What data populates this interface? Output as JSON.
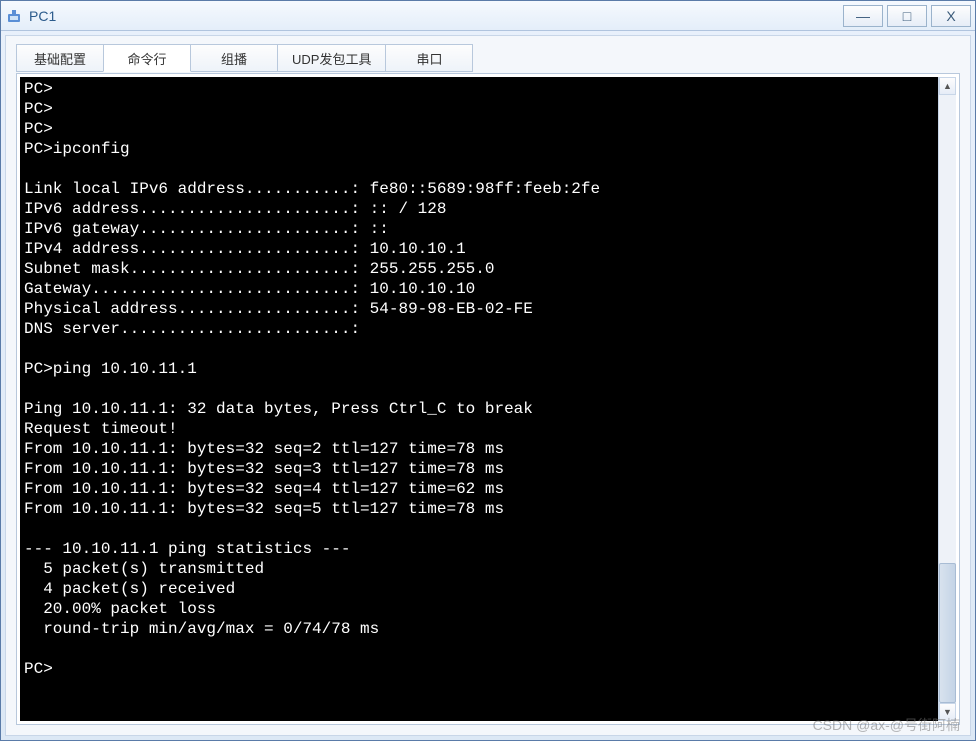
{
  "window": {
    "title": "PC1"
  },
  "controls": {
    "minimize": "—",
    "maximize": "□",
    "close": "X"
  },
  "tabs": [
    {
      "label": "基础配置",
      "active": false
    },
    {
      "label": "命令行",
      "active": true
    },
    {
      "label": "组播",
      "active": false
    },
    {
      "label": "UDP发包工具",
      "active": false
    },
    {
      "label": "串口",
      "active": false
    }
  ],
  "terminal_lines": [
    "PC>",
    "PC>",
    "PC>",
    "PC>ipconfig",
    "",
    "Link local IPv6 address...........: fe80::5689:98ff:feeb:2fe",
    "IPv6 address......................: :: / 128",
    "IPv6 gateway......................: ::",
    "IPv4 address......................: 10.10.10.1",
    "Subnet mask.......................: 255.255.255.0",
    "Gateway...........................: 10.10.10.10",
    "Physical address..................: 54-89-98-EB-02-FE",
    "DNS server........................:",
    "",
    "PC>ping 10.10.11.1",
    "",
    "Ping 10.10.11.1: 32 data bytes, Press Ctrl_C to break",
    "Request timeout!",
    "From 10.10.11.1: bytes=32 seq=2 ttl=127 time=78 ms",
    "From 10.10.11.1: bytes=32 seq=3 ttl=127 time=78 ms",
    "From 10.10.11.1: bytes=32 seq=4 ttl=127 time=62 ms",
    "From 10.10.11.1: bytes=32 seq=5 ttl=127 time=78 ms",
    "",
    "--- 10.10.11.1 ping statistics ---",
    "  5 packet(s) transmitted",
    "  4 packet(s) received",
    "  20.00% packet loss",
    "  round-trip min/avg/max = 0/74/78 ms",
    "",
    "PC>"
  ],
  "scroll": {
    "up": "▲",
    "down": "▼"
  },
  "watermark": "CSDN @ax-@号街阿楠"
}
